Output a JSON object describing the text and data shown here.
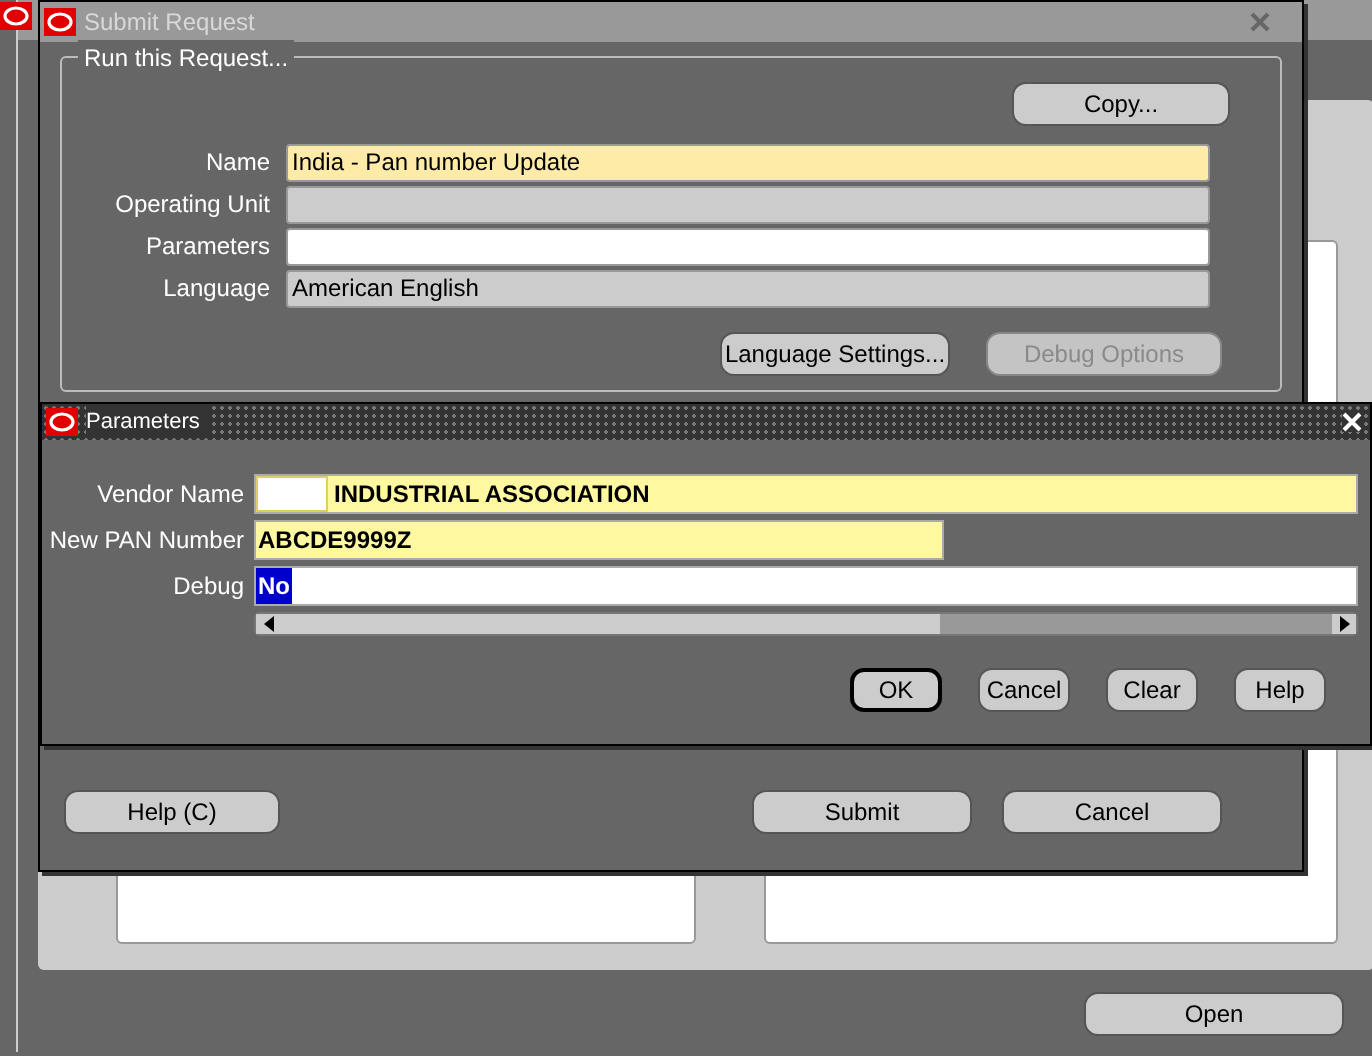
{
  "background_window": {
    "open_button": "Open"
  },
  "submit_request": {
    "title": "Submit Request",
    "group_title": "Run this Request...",
    "copy_button": "Copy...",
    "fields": [
      {
        "label": "Name",
        "value": "India - Pan number Update",
        "kind": "required"
      },
      {
        "label": "Operating Unit",
        "kind": "readonly"
      },
      {
        "label": "Parameters",
        "kind": "optional"
      },
      {
        "label": "Language",
        "value": "American English",
        "kind": "readonly"
      }
    ],
    "buttons": [
      {
        "label": "Language Settings...",
        "disabled": false
      },
      {
        "label": "Debug Options",
        "disabled": true
      }
    ],
    "footer": {
      "help": "Help (C)",
      "actions": [
        "Submit",
        "Cancel"
      ]
    }
  },
  "parameters": {
    "title": "Parameters",
    "fields": [
      {
        "label": "Vendor Name",
        "value": "INDUSTRIAL ASSOCIATION",
        "kind": "required",
        "masked_prefix": true,
        "value_selected": false
      },
      {
        "label": "New PAN Number",
        "value": "ABCDE9999Z",
        "kind": "required_short",
        "masked_prefix": false,
        "value_selected": false
      },
      {
        "label": "Debug",
        "value": "No",
        "kind": "optional",
        "masked_prefix": false,
        "value_selected": true
      }
    ],
    "buttons": [
      {
        "label": "OK",
        "default": true
      },
      {
        "label": "Cancel",
        "default": false
      },
      {
        "label": "Clear",
        "default": false
      },
      {
        "label": "Help",
        "default": false
      }
    ]
  }
}
